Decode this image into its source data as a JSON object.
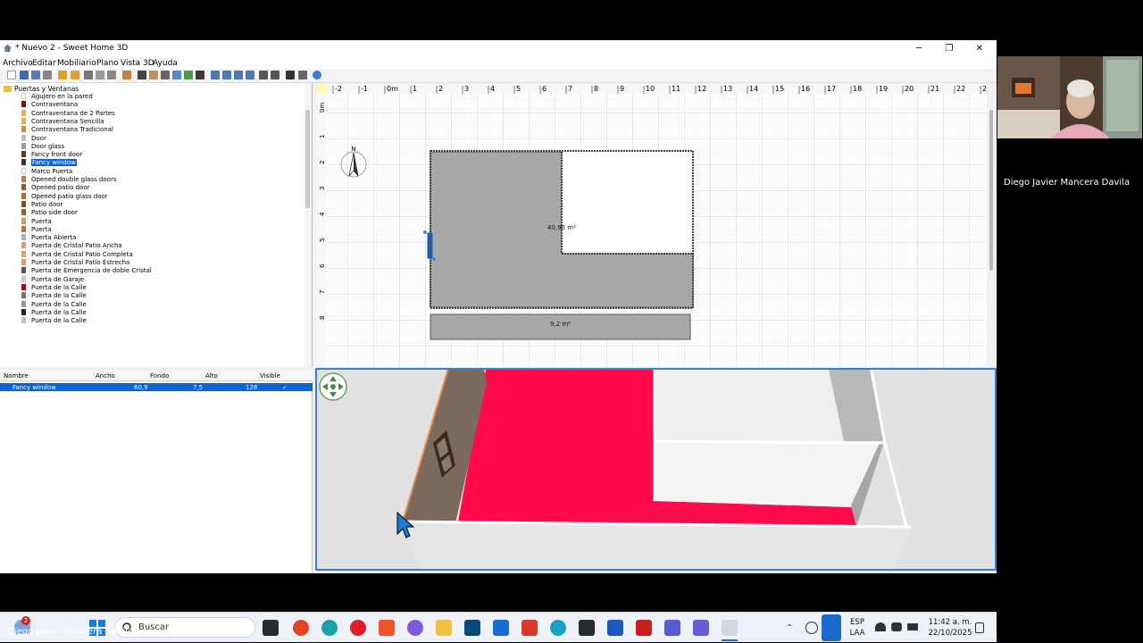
{
  "window": {
    "title": "* Nuevo 2 - Sweet Home 3D",
    "minimize": "─",
    "restore": "❐",
    "close": "✕"
  },
  "menu": [
    "Archivo",
    "Editar",
    "Mobiliario",
    "Plano",
    "Vista 3D",
    "Ayuda"
  ],
  "catalog": {
    "category": "Puertas y Ventanas",
    "items": [
      {
        "label": "Agujero en la pared",
        "color": "#ffffff"
      },
      {
        "label": "Contraventana",
        "color": "#7a1010"
      },
      {
        "label": "Contraventana de 2 Partes",
        "color": "#e0b060"
      },
      {
        "label": "Contraventana Sencilla",
        "color": "#d8b060"
      },
      {
        "label": "Contraventana Tradicional",
        "color": "#c89040"
      },
      {
        "label": "Door",
        "color": "#bbbbbb"
      },
      {
        "label": "Door glass",
        "color": "#999999"
      },
      {
        "label": "Fancy front door",
        "color": "#5a3a20"
      },
      {
        "label": "Fancy window",
        "color": "#333333"
      },
      {
        "label": "Marco Puerta",
        "color": "#ffffff"
      },
      {
        "label": "Opened double glass doors",
        "color": "#b08050"
      },
      {
        "label": "Opened patio door",
        "color": "#8a6030"
      },
      {
        "label": "Opened patio glass door",
        "color": "#a07040"
      },
      {
        "label": "Patio door",
        "color": "#7a5030"
      },
      {
        "label": "Patio side door",
        "color": "#8a6040"
      },
      {
        "label": "Puerta",
        "color": "#c0a070"
      },
      {
        "label": "Puerta",
        "color": "#c07040"
      },
      {
        "label": "Puerta Abierta",
        "color": "#b0b0b0"
      },
      {
        "label": "Puerta de Cristal Patio Ancha",
        "color": "#d0a080"
      },
      {
        "label": "Puerta de Cristal Patio Completa",
        "color": "#d0a080"
      },
      {
        "label": "Puerta de Cristal Patio Estrecha",
        "color": "#d0a080"
      },
      {
        "label": "Puerta de Emergencia de doble Cristal",
        "color": "#555555"
      },
      {
        "label": "Puerta de Garaje",
        "color": "#cccccc"
      },
      {
        "label": "Puerta de la Calle",
        "color": "#a01010"
      },
      {
        "label": "Puerta de la Calle",
        "color": "#777777"
      },
      {
        "label": "Puerta de la Calle",
        "color": "#999999"
      },
      {
        "label": "Puerta de la Calle",
        "color": "#222222"
      },
      {
        "label": "Puerta de la Calle",
        "color": "#c0c0c0"
      }
    ],
    "selected_index": 8
  },
  "furniture_table": {
    "headers": [
      "Nombre",
      "Ancho",
      "Fondo",
      "Alto",
      "Visible"
    ],
    "rows": [
      {
        "name": "Fancy window",
        "width": "60,9",
        "depth": "7,5",
        "height": "128",
        "visible": "✓"
      }
    ]
  },
  "plan": {
    "ruler_x": [
      "-2",
      "-1",
      "0m",
      "1",
      "2",
      "3",
      "4",
      "5",
      "6",
      "7",
      "8",
      "9",
      "10",
      "11",
      "12",
      "13",
      "14",
      "15",
      "16",
      "17",
      "18",
      "19",
      "20",
      "21",
      "22",
      "2"
    ],
    "ruler_y": [
      "0m",
      "1",
      "2",
      "3",
      "4",
      "5",
      "6",
      "7",
      "8"
    ],
    "room_area_main": "40,95 m²",
    "room_area_small": "9,2 m²",
    "compass_letter": "N"
  },
  "colors": {
    "floor": "#ff0a4a",
    "grass": "#6b8a22",
    "room_plan": "#a8a8a8",
    "selection": "#0a64d8",
    "view_border": "#3a7fd6"
  },
  "taskbar": {
    "search_label": "Buscar",
    "badge": "2",
    "lang_top": "ESP",
    "lang_bottom": "LAA",
    "time": "11:42 a. m.",
    "date": "22/10/2025"
  },
  "participant": {
    "name": "Diego Javier Mancera Davila"
  }
}
